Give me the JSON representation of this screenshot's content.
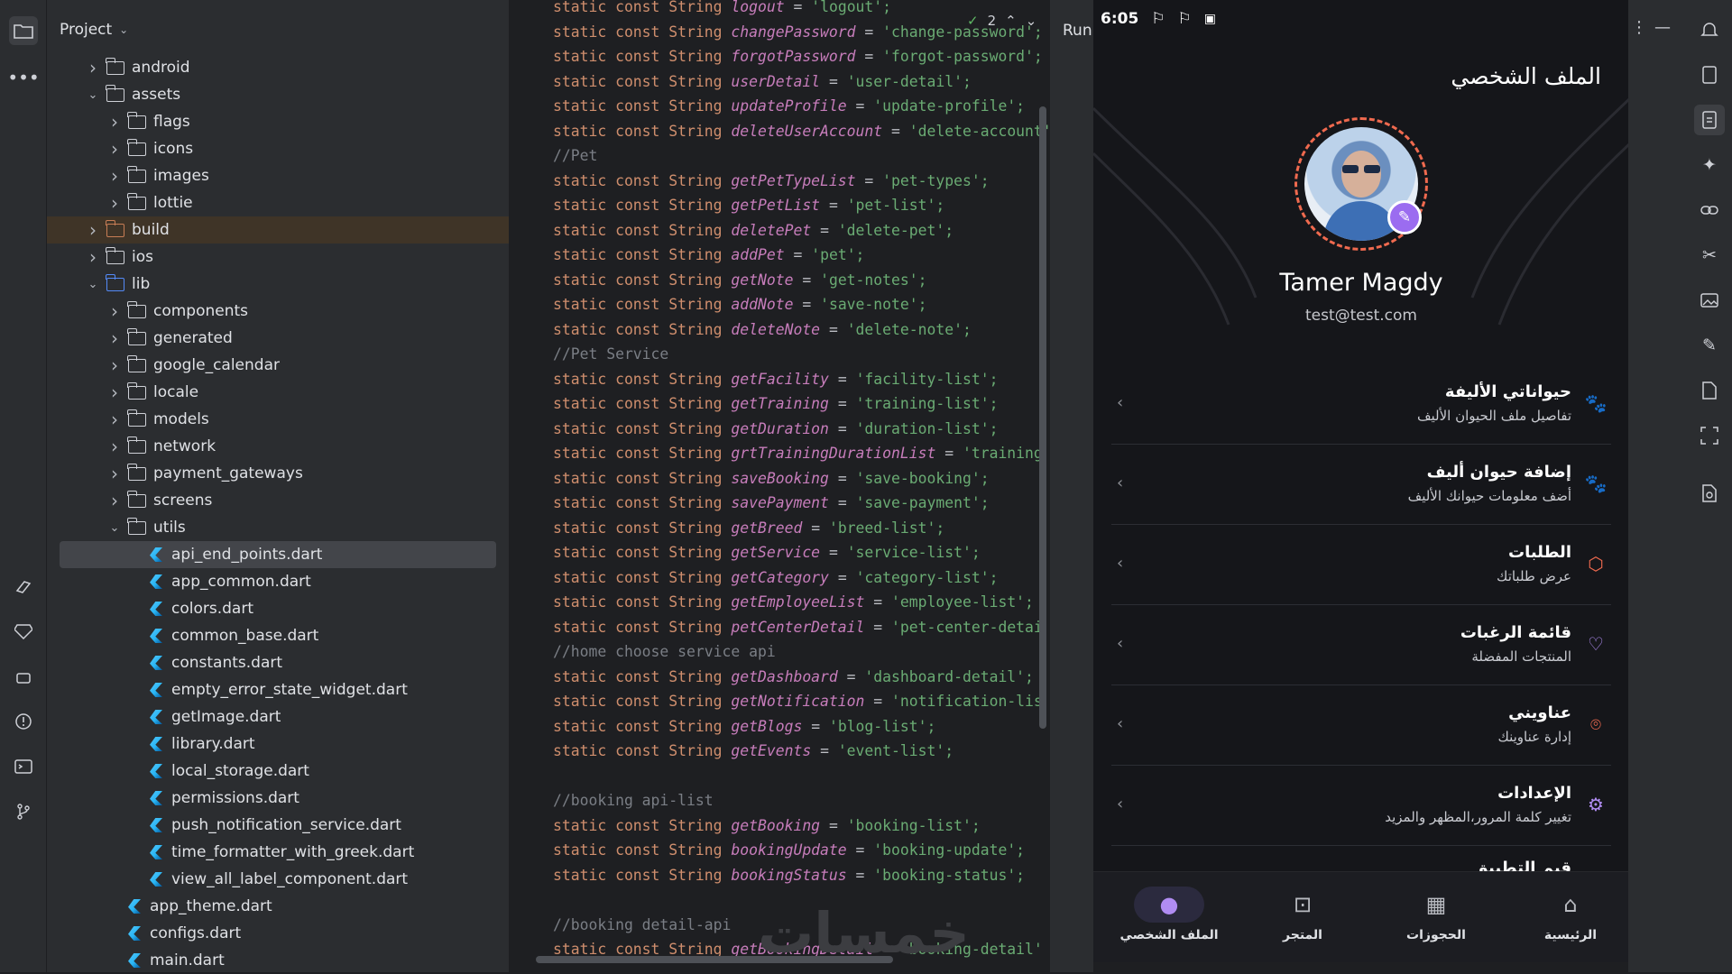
{
  "project": {
    "title": "Project",
    "tree": [
      {
        "label": "android",
        "type": "folder",
        "indent": 1,
        "expanded": false
      },
      {
        "label": "assets",
        "type": "folder",
        "indent": 1,
        "expanded": true
      },
      {
        "label": "flags",
        "type": "folder",
        "indent": 2,
        "expanded": false
      },
      {
        "label": "icons",
        "type": "folder",
        "indent": 2,
        "expanded": false
      },
      {
        "label": "images",
        "type": "folder",
        "indent": 2,
        "expanded": false
      },
      {
        "label": "lottie",
        "type": "folder",
        "indent": 2,
        "expanded": false
      },
      {
        "label": "build",
        "type": "folder-orange",
        "indent": 1,
        "expanded": false
      },
      {
        "label": "ios",
        "type": "folder",
        "indent": 1,
        "expanded": false
      },
      {
        "label": "lib",
        "type": "folder-blue",
        "indent": 1,
        "expanded": true
      },
      {
        "label": "components",
        "type": "folder",
        "indent": 2,
        "expanded": false
      },
      {
        "label": "generated",
        "type": "folder",
        "indent": 2,
        "expanded": false
      },
      {
        "label": "google_calendar",
        "type": "folder",
        "indent": 2,
        "expanded": false
      },
      {
        "label": "locale",
        "type": "folder",
        "indent": 2,
        "expanded": false
      },
      {
        "label": "models",
        "type": "folder",
        "indent": 2,
        "expanded": false
      },
      {
        "label": "network",
        "type": "folder",
        "indent": 2,
        "expanded": false
      },
      {
        "label": "payment_gateways",
        "type": "folder",
        "indent": 2,
        "expanded": false
      },
      {
        "label": "screens",
        "type": "folder",
        "indent": 2,
        "expanded": false
      },
      {
        "label": "utils",
        "type": "folder",
        "indent": 2,
        "expanded": true
      },
      {
        "label": "api_end_points.dart",
        "type": "dart",
        "indent": 3,
        "selected": true
      },
      {
        "label": "app_common.dart",
        "type": "dart",
        "indent": 3
      },
      {
        "label": "colors.dart",
        "type": "dart",
        "indent": 3
      },
      {
        "label": "common_base.dart",
        "type": "dart",
        "indent": 3
      },
      {
        "label": "constants.dart",
        "type": "dart",
        "indent": 3
      },
      {
        "label": "empty_error_state_widget.dart",
        "type": "dart",
        "indent": 3
      },
      {
        "label": "getImage.dart",
        "type": "dart",
        "indent": 3
      },
      {
        "label": "library.dart",
        "type": "dart",
        "indent": 3
      },
      {
        "label": "local_storage.dart",
        "type": "dart",
        "indent": 3
      },
      {
        "label": "permissions.dart",
        "type": "dart",
        "indent": 3
      },
      {
        "label": "push_notification_service.dart",
        "type": "dart",
        "indent": 3
      },
      {
        "label": "time_formatter_with_greek.dart",
        "type": "dart",
        "indent": 3
      },
      {
        "label": "view_all_label_component.dart",
        "type": "dart",
        "indent": 3
      },
      {
        "label": "app_theme.dart",
        "type": "dart",
        "indent": 2
      },
      {
        "label": "configs.dart",
        "type": "dart",
        "indent": 2
      },
      {
        "label": "main.dart",
        "type": "dart",
        "indent": 2
      }
    ]
  },
  "editor": {
    "problems_count": "2",
    "lines": [
      {
        "t": "decl",
        "name": "logout",
        "value": "'logout';"
      },
      {
        "t": "decl",
        "name": "changePassword",
        "value": "'change-password';"
      },
      {
        "t": "decl",
        "name": "forgotPassword",
        "value": "'forgot-password';"
      },
      {
        "t": "decl",
        "name": "userDetail",
        "value": "'user-detail';"
      },
      {
        "t": "decl",
        "name": "updateProfile",
        "value": "'update-profile';"
      },
      {
        "t": "decl",
        "name": "deleteUserAccount",
        "value": "'delete-account';"
      },
      {
        "t": "comment",
        "text": "//Pet"
      },
      {
        "t": "decl",
        "name": "getPetTypeList",
        "value": "'pet-types';"
      },
      {
        "t": "decl",
        "name": "getPetList",
        "value": "'pet-list';"
      },
      {
        "t": "decl",
        "name": "deletePet",
        "value": "'delete-pet';"
      },
      {
        "t": "decl",
        "name": "addPet",
        "value": "'pet';"
      },
      {
        "t": "decl",
        "name": "getNote",
        "value": "'get-notes';"
      },
      {
        "t": "decl",
        "name": "addNote",
        "value": "'save-note';"
      },
      {
        "t": "decl",
        "name": "deleteNote",
        "value": "'delete-note';"
      },
      {
        "t": "comment",
        "text": "//Pet Service"
      },
      {
        "t": "decl",
        "name": "getFacility",
        "value": "'facility-list';"
      },
      {
        "t": "decl",
        "name": "getTraining",
        "value": "'training-list';"
      },
      {
        "t": "decl",
        "name": "getDuration",
        "value": "'duration-list';"
      },
      {
        "t": "decl",
        "name": "grtTrainingDurationList",
        "value": "'training"
      },
      {
        "t": "decl",
        "name": "saveBooking",
        "value": "'save-booking';"
      },
      {
        "t": "decl",
        "name": "savePayment",
        "value": "'save-payment';"
      },
      {
        "t": "decl",
        "name": "getBreed",
        "value": "'breed-list';"
      },
      {
        "t": "decl",
        "name": "getService",
        "value": "'service-list';"
      },
      {
        "t": "decl",
        "name": "getCategory",
        "value": "'category-list';"
      },
      {
        "t": "decl",
        "name": "getEmployeeList",
        "value": "'employee-list';"
      },
      {
        "t": "decl",
        "name": "petCenterDetail",
        "value": "'pet-center-detai"
      },
      {
        "t": "comment",
        "text": "//home choose service api"
      },
      {
        "t": "decl",
        "name": "getDashboard",
        "value": "'dashboard-detail';"
      },
      {
        "t": "decl",
        "name": "getNotification",
        "value": "'notification-lis"
      },
      {
        "t": "decl",
        "name": "getBlogs",
        "value": "'blog-list';"
      },
      {
        "t": "decl",
        "name": "getEvents",
        "value": "'event-list';"
      },
      {
        "t": "blank"
      },
      {
        "t": "comment",
        "text": "//booking api-list"
      },
      {
        "t": "decl",
        "name": "getBooking",
        "value": "'booking-list';"
      },
      {
        "t": "decl",
        "name": "bookingUpdate",
        "value": "'booking-update';"
      },
      {
        "t": "decl",
        "name": "bookingStatus",
        "value": "'booking-status';"
      },
      {
        "t": "blank"
      },
      {
        "t": "comment",
        "text": "//booking detail-api"
      },
      {
        "t": "decl",
        "name": "getBookingDetail",
        "value": "'booking-detail'"
      }
    ],
    "keyword_prefix": "static const String",
    "equals": "="
  },
  "run_label": "Run",
  "phone": {
    "status_time": "6:05",
    "title": "الملف الشخصي",
    "name": "Tamer Magdy",
    "email": "test@test.com",
    "menu": [
      {
        "title": "حيواناتي الأليفة",
        "subtitle": "تفاصيل ملف الحيوان الأليف",
        "icon": "paw-icon",
        "glyph": "🐾",
        "orange": true
      },
      {
        "title": "إضافة حيوان أليف",
        "subtitle": "أضف معلومات حيوانك الأليف",
        "icon": "paw-add-icon",
        "glyph": "🐾",
        "orange": false
      },
      {
        "title": "الطلبات",
        "subtitle": "عرض طلباتك",
        "icon": "box-icon",
        "glyph": "⬡",
        "orange": true
      },
      {
        "title": "قائمة الرغبات",
        "subtitle": "المنتجات المفضلة",
        "icon": "heart-icon",
        "glyph": "♡",
        "orange": false
      },
      {
        "title": "عناويني",
        "subtitle": "إدارة عناوينك",
        "icon": "location-pin-icon",
        "glyph": "⌾",
        "orange": true
      },
      {
        "title": "الإعدادات",
        "subtitle": "تغيير كلمة المرور،المظهر والمزيد",
        "icon": "gear-icon",
        "glyph": "⚙",
        "orange": false
      }
    ],
    "cut_item_title": "قيم التطبيق",
    "nav": [
      {
        "label": "الملف الشخصي",
        "icon": "user-icon",
        "active": true
      },
      {
        "label": "المتجر",
        "icon": "shopping-bag-icon",
        "active": false
      },
      {
        "label": "الحجوزات",
        "icon": "calendar-icon",
        "active": false
      },
      {
        "label": "الرئيسية",
        "icon": "home-icon",
        "active": false
      }
    ]
  },
  "watermark": "خمسات",
  "colors": {
    "accent": "#b08cf2",
    "ring": "#f06a4f",
    "string": "#6aab73",
    "keyword": "#cf8e6d",
    "identifier": "#c77dbb"
  }
}
